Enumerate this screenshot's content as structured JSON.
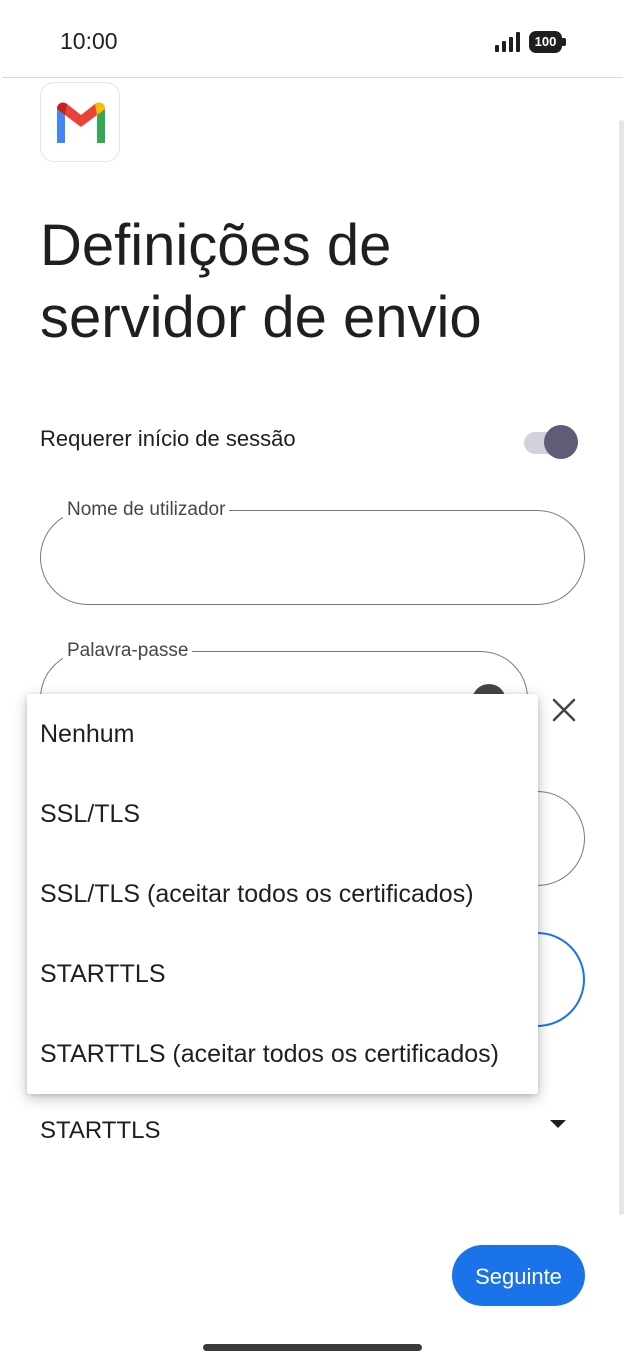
{
  "status_bar": {
    "time": "10:00",
    "battery_level": "100",
    "icons": [
      "signal-icon",
      "battery-icon"
    ]
  },
  "app": {
    "logo": "gmail-logo-icon"
  },
  "page": {
    "title": "Definições de servidor de envio"
  },
  "login_toggle": {
    "label": "Requerer início de sessão",
    "enabled": true
  },
  "fields": {
    "username": {
      "label": "Nome de utilizador",
      "value": ""
    },
    "password": {
      "label": "Palavra-passe",
      "value": ""
    }
  },
  "security": {
    "selected": "STARTTLS",
    "options": [
      "Nenhum",
      "SSL/TLS",
      "SSL/TLS (aceitar todos os certificados)",
      "STARTTLS",
      "STARTTLS (aceitar todos os certificados)"
    ]
  },
  "actions": {
    "next_label": "Seguinte"
  },
  "colors": {
    "accent": "#1a73e8",
    "toggle_thumb": "#625b77",
    "toggle_track": "#d4d0dd"
  }
}
